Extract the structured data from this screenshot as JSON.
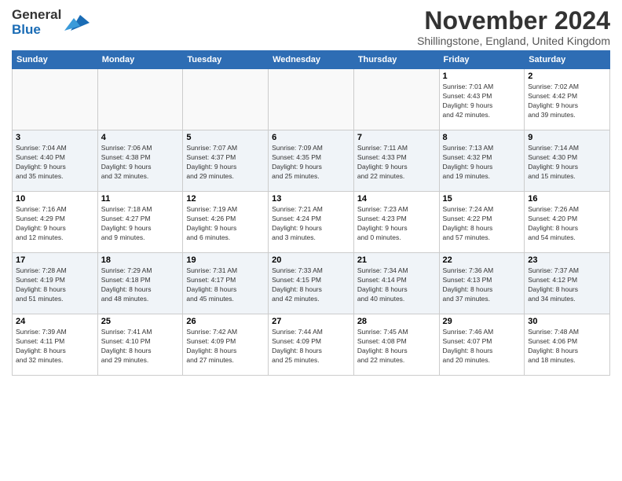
{
  "header": {
    "logo_line1": "General",
    "logo_line2": "Blue",
    "month": "November 2024",
    "location": "Shillingstone, England, United Kingdom"
  },
  "days_of_week": [
    "Sunday",
    "Monday",
    "Tuesday",
    "Wednesday",
    "Thursday",
    "Friday",
    "Saturday"
  ],
  "weeks": [
    {
      "alt": false,
      "days": [
        {
          "num": "",
          "detail": ""
        },
        {
          "num": "",
          "detail": ""
        },
        {
          "num": "",
          "detail": ""
        },
        {
          "num": "",
          "detail": ""
        },
        {
          "num": "",
          "detail": ""
        },
        {
          "num": "1",
          "detail": "Sunrise: 7:01 AM\nSunset: 4:43 PM\nDaylight: 9 hours\nand 42 minutes."
        },
        {
          "num": "2",
          "detail": "Sunrise: 7:02 AM\nSunset: 4:42 PM\nDaylight: 9 hours\nand 39 minutes."
        }
      ]
    },
    {
      "alt": true,
      "days": [
        {
          "num": "3",
          "detail": "Sunrise: 7:04 AM\nSunset: 4:40 PM\nDaylight: 9 hours\nand 35 minutes."
        },
        {
          "num": "4",
          "detail": "Sunrise: 7:06 AM\nSunset: 4:38 PM\nDaylight: 9 hours\nand 32 minutes."
        },
        {
          "num": "5",
          "detail": "Sunrise: 7:07 AM\nSunset: 4:37 PM\nDaylight: 9 hours\nand 29 minutes."
        },
        {
          "num": "6",
          "detail": "Sunrise: 7:09 AM\nSunset: 4:35 PM\nDaylight: 9 hours\nand 25 minutes."
        },
        {
          "num": "7",
          "detail": "Sunrise: 7:11 AM\nSunset: 4:33 PM\nDaylight: 9 hours\nand 22 minutes."
        },
        {
          "num": "8",
          "detail": "Sunrise: 7:13 AM\nSunset: 4:32 PM\nDaylight: 9 hours\nand 19 minutes."
        },
        {
          "num": "9",
          "detail": "Sunrise: 7:14 AM\nSunset: 4:30 PM\nDaylight: 9 hours\nand 15 minutes."
        }
      ]
    },
    {
      "alt": false,
      "days": [
        {
          "num": "10",
          "detail": "Sunrise: 7:16 AM\nSunset: 4:29 PM\nDaylight: 9 hours\nand 12 minutes."
        },
        {
          "num": "11",
          "detail": "Sunrise: 7:18 AM\nSunset: 4:27 PM\nDaylight: 9 hours\nand 9 minutes."
        },
        {
          "num": "12",
          "detail": "Sunrise: 7:19 AM\nSunset: 4:26 PM\nDaylight: 9 hours\nand 6 minutes."
        },
        {
          "num": "13",
          "detail": "Sunrise: 7:21 AM\nSunset: 4:24 PM\nDaylight: 9 hours\nand 3 minutes."
        },
        {
          "num": "14",
          "detail": "Sunrise: 7:23 AM\nSunset: 4:23 PM\nDaylight: 9 hours\nand 0 minutes."
        },
        {
          "num": "15",
          "detail": "Sunrise: 7:24 AM\nSunset: 4:22 PM\nDaylight: 8 hours\nand 57 minutes."
        },
        {
          "num": "16",
          "detail": "Sunrise: 7:26 AM\nSunset: 4:20 PM\nDaylight: 8 hours\nand 54 minutes."
        }
      ]
    },
    {
      "alt": true,
      "days": [
        {
          "num": "17",
          "detail": "Sunrise: 7:28 AM\nSunset: 4:19 PM\nDaylight: 8 hours\nand 51 minutes."
        },
        {
          "num": "18",
          "detail": "Sunrise: 7:29 AM\nSunset: 4:18 PM\nDaylight: 8 hours\nand 48 minutes."
        },
        {
          "num": "19",
          "detail": "Sunrise: 7:31 AM\nSunset: 4:17 PM\nDaylight: 8 hours\nand 45 minutes."
        },
        {
          "num": "20",
          "detail": "Sunrise: 7:33 AM\nSunset: 4:15 PM\nDaylight: 8 hours\nand 42 minutes."
        },
        {
          "num": "21",
          "detail": "Sunrise: 7:34 AM\nSunset: 4:14 PM\nDaylight: 8 hours\nand 40 minutes."
        },
        {
          "num": "22",
          "detail": "Sunrise: 7:36 AM\nSunset: 4:13 PM\nDaylight: 8 hours\nand 37 minutes."
        },
        {
          "num": "23",
          "detail": "Sunrise: 7:37 AM\nSunset: 4:12 PM\nDaylight: 8 hours\nand 34 minutes."
        }
      ]
    },
    {
      "alt": false,
      "days": [
        {
          "num": "24",
          "detail": "Sunrise: 7:39 AM\nSunset: 4:11 PM\nDaylight: 8 hours\nand 32 minutes."
        },
        {
          "num": "25",
          "detail": "Sunrise: 7:41 AM\nSunset: 4:10 PM\nDaylight: 8 hours\nand 29 minutes."
        },
        {
          "num": "26",
          "detail": "Sunrise: 7:42 AM\nSunset: 4:09 PM\nDaylight: 8 hours\nand 27 minutes."
        },
        {
          "num": "27",
          "detail": "Sunrise: 7:44 AM\nSunset: 4:09 PM\nDaylight: 8 hours\nand 25 minutes."
        },
        {
          "num": "28",
          "detail": "Sunrise: 7:45 AM\nSunset: 4:08 PM\nDaylight: 8 hours\nand 22 minutes."
        },
        {
          "num": "29",
          "detail": "Sunrise: 7:46 AM\nSunset: 4:07 PM\nDaylight: 8 hours\nand 20 minutes."
        },
        {
          "num": "30",
          "detail": "Sunrise: 7:48 AM\nSunset: 4:06 PM\nDaylight: 8 hours\nand 18 minutes."
        }
      ]
    }
  ]
}
